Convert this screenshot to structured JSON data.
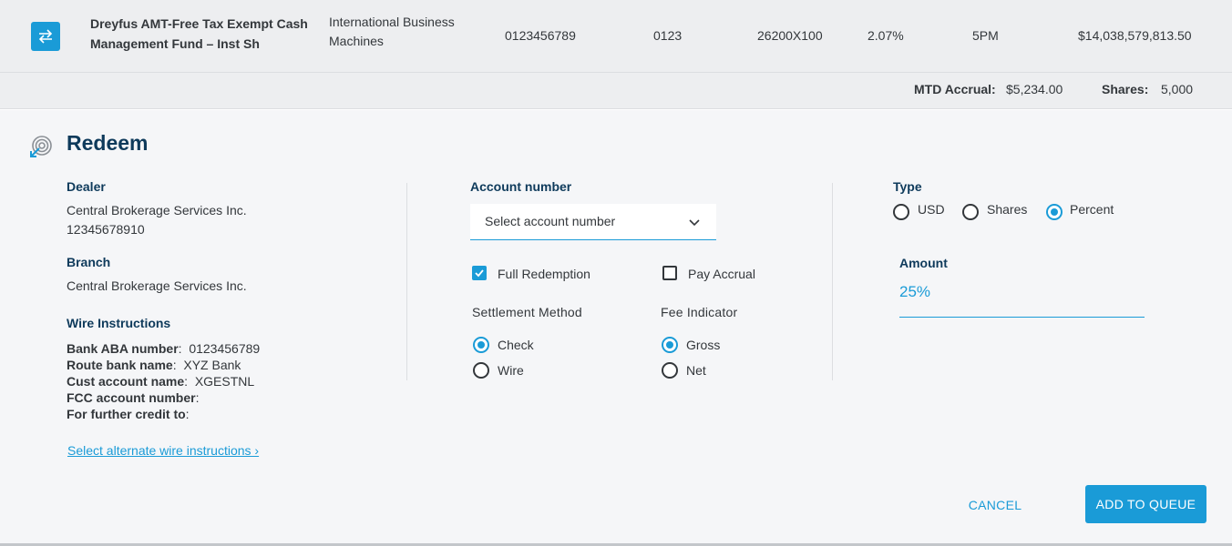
{
  "fund": {
    "name": "Dreyfus AMT-Free Tax Exempt Cash Management Fund – Inst Sh",
    "company": "International Business Machines",
    "account": "0123456789",
    "code": "0123",
    "ticker": "26200X100",
    "yield": "2.07%",
    "cutoff": "5PM",
    "balance": "$14,038,579,813.50",
    "icon": "swap-arrows-icon"
  },
  "accrual": {
    "mtd_label": "MTD Accrual:",
    "mtd_value": "$5,234.00",
    "shares_label": "Shares:",
    "shares_value": "5,000"
  },
  "redeem": {
    "title": "Redeem",
    "icon": "redeem-target-icon",
    "dealer": {
      "label": "Dealer",
      "name": "Central Brokerage Services Inc.",
      "number": "12345678910"
    },
    "branch": {
      "label": "Branch",
      "name": "Central Brokerage Services Inc."
    },
    "wire": {
      "label": "Wire Instructions",
      "lines": [
        {
          "label": "Bank ABA number",
          "value": "0123456789"
        },
        {
          "label": "Route bank name",
          "value": "XYZ Bank"
        },
        {
          "label": "Cust account name",
          "value": "XGESTNL"
        },
        {
          "label": "FCC account number",
          "value": ""
        },
        {
          "label": "For further credit to",
          "value": ""
        }
      ],
      "alt_link": "Select alternate wire instructions ›"
    },
    "account": {
      "label": "Account number",
      "placeholder": "Select account number"
    },
    "full_redemption": {
      "label": "Full Redemption",
      "checked": true
    },
    "pay_accrual": {
      "label": "Pay Accrual",
      "checked": false
    },
    "settlement": {
      "label": "Settlement Method",
      "options": [
        {
          "label": "Check",
          "selected": true
        },
        {
          "label": "Wire",
          "selected": false
        }
      ]
    },
    "fee": {
      "label": "Fee Indicator",
      "options": [
        {
          "label": "Gross",
          "selected": true
        },
        {
          "label": "Net",
          "selected": false
        }
      ]
    },
    "type": {
      "label": "Type",
      "options": [
        {
          "label": "USD",
          "selected": false
        },
        {
          "label": "Shares",
          "selected": false
        },
        {
          "label": "Percent",
          "selected": true
        }
      ]
    },
    "amount": {
      "label": "Amount",
      "value": "25%"
    },
    "cancel_label": "CANCEL",
    "submit_label": "ADD TO QUEUE"
  },
  "colors": {
    "accent": "#1a9bd7",
    "heading": "#0e3a5b",
    "row_bg": "#edeef0",
    "panel_bg": "#f5f6f8"
  }
}
